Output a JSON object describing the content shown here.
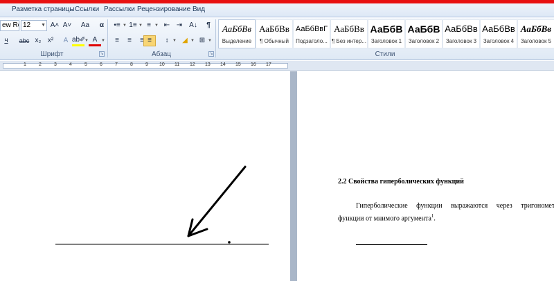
{
  "tabs": [
    "Разметка страницы",
    "Ссылки",
    "Рассылки",
    "Рецензирование",
    "Вид"
  ],
  "font": {
    "name": "ew Ro",
    "size": "12",
    "group_label": "Шрифт"
  },
  "paragraph": {
    "group_label": "Абзац"
  },
  "styles": {
    "group_label": "Стили",
    "items": [
      {
        "preview": "АаБбВв",
        "name": "Выделение"
      },
      {
        "preview": "АаБбВв",
        "name": "¶ Обычный"
      },
      {
        "preview": "АаБбВвГ",
        "name": "Подзаголо..."
      },
      {
        "preview": "АаБбВв",
        "name": "¶ Без интер..."
      },
      {
        "preview": "АаБбВ",
        "name": "Заголовок 1"
      },
      {
        "preview": "АаБбВ",
        "name": "Заголовок 2"
      },
      {
        "preview": "АаБбВв",
        "name": "Заголовок 3"
      },
      {
        "preview": "АаБбВв",
        "name": "Заголовок 4"
      },
      {
        "preview": "АаБбВв",
        "name": "Заголовок 5"
      }
    ]
  },
  "ruler": {
    "numbers": [
      "1",
      "2",
      "3",
      "4",
      "5",
      "6",
      "7",
      "8",
      "9",
      "10",
      "11",
      "12",
      "13",
      "14",
      "15",
      "16",
      "17"
    ]
  },
  "document": {
    "heading": "2.2 Свойства гиперболических  функций",
    "paragraph_line1": "Гиперболические функции выражаются через тригонометрич",
    "paragraph_line2": "функции от мнимого аргумента",
    "footnote_mark": "1",
    "period": "."
  },
  "colors": {
    "title_strip": "#e81010",
    "highlight": "#ffff00",
    "font_color": "#e00000",
    "active_button": "#f8d573"
  },
  "icons": {
    "grow_font": "A˄",
    "shrink_font": "A˅",
    "clear_format": "Aa",
    "change_case": "α",
    "paragraph_mark": "¶",
    "underline": "ч",
    "strikethrough": "abc",
    "subscript": "x₂",
    "superscript": "x²",
    "text_effects": "A",
    "highlight": "ab✐",
    "font_color": "A",
    "bullets": "•≡",
    "numbering": "1≡",
    "multilevel": "≡",
    "decrease_indent": "⇤",
    "increase_indent": "⇥",
    "sort": "A↓",
    "align_left": "≡",
    "align_center": "≡",
    "align_right": "≡",
    "justify": "≡",
    "line_spacing": "↕",
    "shading": "◢",
    "borders": "⊞"
  }
}
